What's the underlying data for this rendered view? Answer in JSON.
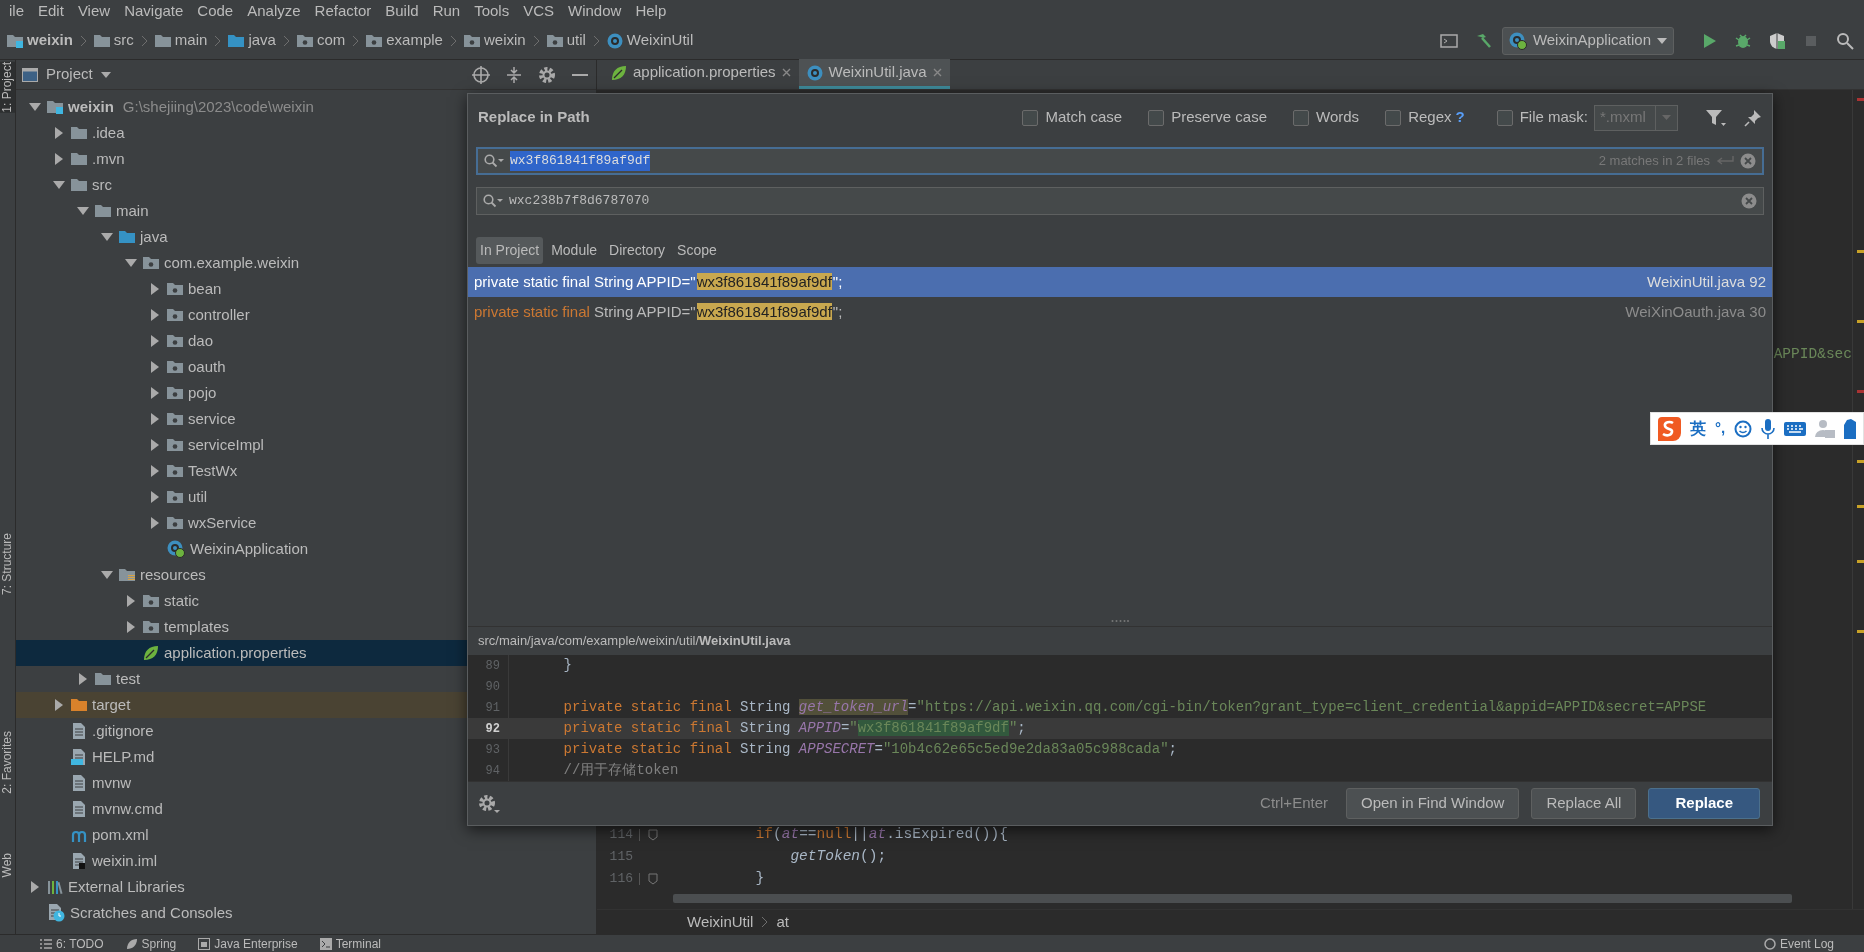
{
  "menu_bar": {
    "items": [
      "ile",
      "Edit",
      "View",
      "Navigate",
      "Code",
      "Analyze",
      "Refactor",
      "Build",
      "Run",
      "Tools",
      "VCS",
      "Window",
      "Help"
    ]
  },
  "breadcrumb": [
    {
      "label": "weixin",
      "kind": "module"
    },
    {
      "label": "src",
      "kind": "folder"
    },
    {
      "label": "main",
      "kind": "folder"
    },
    {
      "label": "java",
      "kind": "source-folder"
    },
    {
      "label": "com",
      "kind": "package"
    },
    {
      "label": "example",
      "kind": "package"
    },
    {
      "label": "weixin",
      "kind": "package"
    },
    {
      "label": "util",
      "kind": "package"
    },
    {
      "label": "WeixinUtil",
      "kind": "class"
    }
  ],
  "run_configuration": {
    "label": "WeixinApplication"
  },
  "side_strip": [
    {
      "label": "1: Project",
      "selected": true
    },
    {
      "label": "7: Structure",
      "selected": false
    },
    {
      "label": "2: Favorites",
      "selected": false
    },
    {
      "label": "Web",
      "selected": false
    }
  ],
  "project_panel": {
    "title": "Project",
    "tree": [
      {
        "label": "weixin",
        "path": "G:\\shejiing\\2023\\code\\weixin",
        "kind": "module",
        "expanded": true,
        "selected": false,
        "children": [
          {
            "label": ".idea",
            "kind": "folder",
            "expanded": false,
            "selected": false
          },
          {
            "label": ".mvn",
            "kind": "folder",
            "expanded": false,
            "selected": false
          },
          {
            "label": "src",
            "kind": "folder",
            "expanded": true,
            "selected": false,
            "children": [
              {
                "label": "main",
                "kind": "folder",
                "expanded": true,
                "selected": false,
                "children": [
                  {
                    "label": "java",
                    "kind": "source-folder",
                    "expanded": true,
                    "selected": false,
                    "children": [
                      {
                        "label": "com.example.weixin",
                        "kind": "package",
                        "expanded": true,
                        "selected": false,
                        "children": [
                          {
                            "label": "bean",
                            "kind": "package",
                            "expanded": false,
                            "selected": false
                          },
                          {
                            "label": "controller",
                            "kind": "package",
                            "expanded": false,
                            "selected": false
                          },
                          {
                            "label": "dao",
                            "kind": "package",
                            "expanded": false,
                            "selected": false
                          },
                          {
                            "label": "oauth",
                            "kind": "package",
                            "expanded": false,
                            "selected": false
                          },
                          {
                            "label": "pojo",
                            "kind": "package",
                            "expanded": false,
                            "selected": false
                          },
                          {
                            "label": "service",
                            "kind": "package",
                            "expanded": false,
                            "selected": false
                          },
                          {
                            "label": "serviceImpl",
                            "kind": "package",
                            "expanded": false,
                            "selected": false
                          },
                          {
                            "label": "TestWx",
                            "kind": "package",
                            "expanded": false,
                            "selected": false
                          },
                          {
                            "label": "util",
                            "kind": "package",
                            "expanded": false,
                            "selected": false
                          },
                          {
                            "label": "wxService",
                            "kind": "package",
                            "expanded": false,
                            "selected": false
                          },
                          {
                            "label": "WeixinApplication",
                            "kind": "spring-class",
                            "selected": false
                          }
                        ]
                      }
                    ]
                  },
                  {
                    "label": "resources",
                    "kind": "resources-folder",
                    "expanded": true,
                    "selected": false,
                    "children": [
                      {
                        "label": "static",
                        "kind": "package",
                        "expanded": false,
                        "selected": false
                      },
                      {
                        "label": "templates",
                        "kind": "package",
                        "expanded": false,
                        "selected": false
                      },
                      {
                        "label": "application.properties",
                        "kind": "spring-properties",
                        "selected": true
                      }
                    ]
                  }
                ]
              },
              {
                "label": "test",
                "kind": "folder",
                "expanded": false,
                "selected": false
              }
            ]
          },
          {
            "label": "target",
            "kind": "excluded-folder",
            "expanded": false,
            "selected": false
          },
          {
            "label": ".gitignore",
            "kind": "file",
            "selected": false
          },
          {
            "label": "HELP.md",
            "kind": "md-file",
            "selected": false
          },
          {
            "label": "mvnw",
            "kind": "file",
            "selected": false
          },
          {
            "label": "mvnw.cmd",
            "kind": "file",
            "selected": false
          },
          {
            "label": "pom.xml",
            "kind": "maven-file",
            "selected": false
          },
          {
            "label": "weixin.iml",
            "kind": "iml-file",
            "selected": false
          }
        ]
      },
      {
        "label": "External Libraries",
        "kind": "libraries",
        "expanded": false,
        "selected": false
      },
      {
        "label": "Scratches and Consoles",
        "kind": "scratches",
        "selected": false
      }
    ]
  },
  "editor_tabs": [
    {
      "label": "application.properties",
      "kind": "spring-properties",
      "selected": false
    },
    {
      "label": "WeixinUtil.java",
      "kind": "class",
      "selected": true
    }
  ],
  "editor": {
    "overflow_text": "APPID&sec",
    "lines": [
      {
        "number": "114",
        "fold": true,
        "tokens": [
          {
            "kind": "keyword",
            "text": "        if"
          },
          {
            "kind": "plain",
            "text": "("
          },
          {
            "kind": "field",
            "text": "at"
          },
          {
            "kind": "plain",
            "text": "=="
          },
          {
            "kind": "keyword",
            "text": "null"
          },
          {
            "kind": "plain",
            "text": "||"
          },
          {
            "kind": "field",
            "text": "at"
          },
          {
            "kind": "plain",
            "text": ".isExpired()){"
          }
        ]
      },
      {
        "number": "115",
        "fold": false,
        "tokens": [
          {
            "kind": "static",
            "text": "            getToken"
          },
          {
            "kind": "plain",
            "text": "();"
          }
        ]
      },
      {
        "number": "116",
        "fold": true,
        "tokens": [
          {
            "kind": "plain",
            "text": "        }"
          }
        ]
      }
    ],
    "breadcrumb": [
      "WeixinUtil",
      "at"
    ]
  },
  "replace_dialog": {
    "title": "Replace in Path",
    "options": [
      {
        "label": "Match case",
        "checked": false
      },
      {
        "label": "Preserve case",
        "checked": false
      },
      {
        "label": "Words",
        "checked": false
      },
      {
        "label": "Regex",
        "checked": false,
        "help": "?"
      }
    ],
    "file_mask": {
      "label": "File mask:",
      "checked": false,
      "value": "*.mxml",
      "disabled": true
    },
    "search": {
      "value": "wx3f861841f89af9df",
      "info": "2 matches in 2 files",
      "focused": true
    },
    "replace": {
      "value": "wxc238b7f8d6787070",
      "focused": false
    },
    "scopes": [
      {
        "label": "In Project",
        "selected": true
      },
      {
        "label": "Module",
        "selected": false
      },
      {
        "label": "Directory",
        "selected": false
      },
      {
        "label": "Scope",
        "selected": false
      }
    ],
    "results": [
      {
        "keyword": "private static final",
        "text": " String APPID=\"",
        "match": "wx3f861841f89af9df",
        "after": "\";",
        "file": "WeixinUtil.java 92",
        "selected": true
      },
      {
        "keyword": "private static final",
        "text": " String APPID=\"",
        "match": "wx3f861841f89af9df",
        "after": "\";",
        "file": "WeiXinOauth.java 30",
        "selected": false
      }
    ],
    "preview": {
      "path": "src/main/java/com/example/weixin/util/**WeixinUtil.java**",
      "lines": [
        {
          "number": "89",
          "current": false,
          "tokens": [
            {
              "kind": "plain",
              "text": "    }"
            }
          ]
        },
        {
          "number": "90",
          "current": false
        },
        {
          "number": "91",
          "current": false,
          "tokens": [
            {
              "kind": "keyword",
              "text": "    private static final "
            },
            {
              "kind": "plain",
              "text": "String "
            },
            {
              "kind": "usage",
              "text": "get_token_url"
            },
            {
              "kind": "plain",
              "text": "="
            },
            {
              "kind": "string",
              "text": "\"https://api.weixin.qq.com/cgi-bin/token?grant_type=client_credential&appid=APPID&secret=APPSE"
            }
          ]
        },
        {
          "number": "92",
          "current": true,
          "tokens": [
            {
              "kind": "keyword",
              "text": "    private static final "
            },
            {
              "kind": "plain",
              "text": "String "
            },
            {
              "kind": "field",
              "text": "APPID"
            },
            {
              "kind": "plain",
              "text": "="
            },
            {
              "kind": "string",
              "text": "\""
            },
            {
              "kind": "match",
              "text": "wx3f861841f89af9df"
            },
            {
              "kind": "string",
              "text": "\""
            },
            {
              "kind": "plain",
              "text": ";"
            }
          ]
        },
        {
          "number": "93",
          "current": false,
          "tokens": [
            {
              "kind": "keyword",
              "text": "    private static final "
            },
            {
              "kind": "plain",
              "text": "String "
            },
            {
              "kind": "field",
              "text": "APPSECRET"
            },
            {
              "kind": "plain",
              "text": "="
            },
            {
              "kind": "string",
              "text": "\"10b4c62e65c5ed9e2da83a05c988cada\""
            },
            {
              "kind": "plain",
              "text": ";"
            }
          ]
        },
        {
          "number": "94",
          "current": false,
          "tokens": [
            {
              "kind": "comment",
              "text": "    //用于存储token"
            }
          ]
        }
      ]
    },
    "shortcut": "Ctrl+Enter",
    "buttons": [
      {
        "label": "Open in Find Window",
        "default": false
      },
      {
        "label": "Replace All",
        "default": false
      },
      {
        "label": "Replace",
        "default": true
      }
    ]
  },
  "ime_toolbar": {
    "language": "英",
    "punctuation": "°,"
  },
  "bottom_bar": {
    "tools": [
      {
        "label": "6: TODO",
        "kind": "todo"
      },
      {
        "label": "Spring",
        "kind": "spring"
      },
      {
        "label": "Java Enterprise",
        "kind": "enterprise"
      },
      {
        "label": "Terminal",
        "kind": "terminal"
      }
    ],
    "event_log": "Event Log"
  }
}
